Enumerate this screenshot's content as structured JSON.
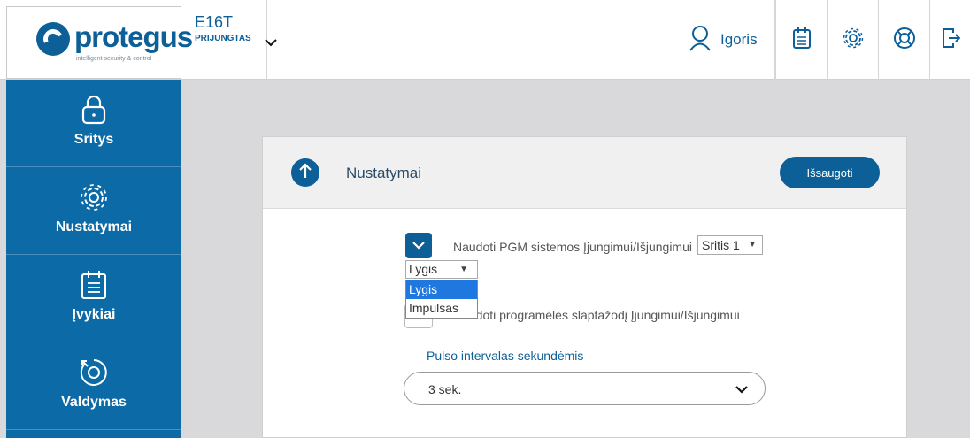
{
  "brand": {
    "name": "protegus",
    "tagline": "intelligent security & control"
  },
  "device": {
    "name": "E16T",
    "status": "PRIJUNGTAS"
  },
  "user": {
    "name": "Igoris"
  },
  "toolbar_icons": [
    "calendar-icon",
    "gear-icon",
    "lifebuoy-icon",
    "logout-icon"
  ],
  "sidebar": {
    "items": [
      {
        "label": "Sritys",
        "icon": "lock-icon"
      },
      {
        "label": "Nustatymai",
        "icon": "gear-icon"
      },
      {
        "label": "Įvykiai",
        "icon": "calendar-icon"
      },
      {
        "label": "Valdymas",
        "icon": "dial-icon"
      }
    ]
  },
  "card": {
    "title": "Nustatymai",
    "save_label": "Išsaugoti",
    "pgm_label": "Naudoti PGM sistemos Įjungimui/Išjungimui 1",
    "area_select": {
      "value": "Sritis 1"
    },
    "mode_select": {
      "value": "Lygis",
      "options": [
        "Lygis",
        "Impulsas"
      ],
      "highlighted": "Lygis"
    },
    "app_password_label": "Naudoti programėlės slaptažodį Įjungimui/Išjungimui",
    "pulse": {
      "label": "Pulso intervalas sekundėmis",
      "value": "3 sek."
    }
  },
  "colors": {
    "primary": "#0c5f97",
    "sidebar": "#0c6aa6",
    "background": "#d9d9dc",
    "highlight": "#1e78e0"
  }
}
